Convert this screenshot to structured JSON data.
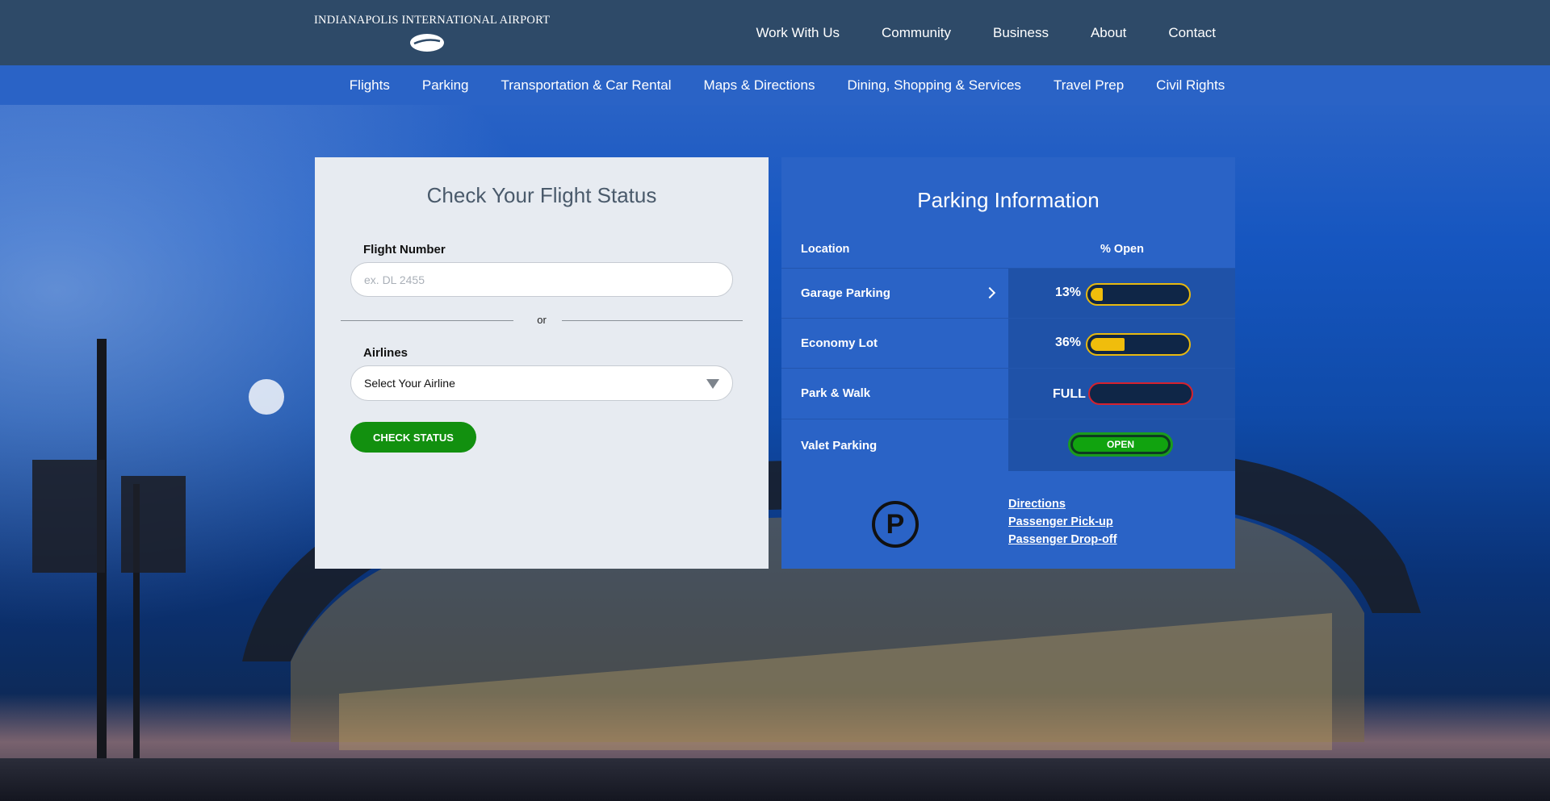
{
  "header": {
    "logo_text": "INDIANAPOLIS INTERNATIONAL AIRPORT",
    "nav": [
      "Work With Us",
      "Community",
      "Business",
      "About",
      "Contact"
    ]
  },
  "subnav": [
    "Flights",
    "Parking",
    "Transportation & Car Rental",
    "Maps & Directions",
    "Dining, Shopping & Services",
    "Travel Prep",
    "Civil Rights"
  ],
  "flight_status": {
    "title": "Check Your Flight Status",
    "flight_number_label": "Flight Number",
    "flight_number_placeholder": "ex. DL 2455",
    "flight_number_value": "",
    "or_text": "or",
    "airlines_label": "Airlines",
    "airline_selected": "Select Your Airline",
    "check_button": "CHECK STATUS"
  },
  "parking": {
    "title": "Parking Information",
    "col_location": "Location",
    "col_open": "% Open",
    "rows": [
      {
        "location": "Garage Parking",
        "status_text": "13%",
        "percent_open": 13,
        "state": "partial",
        "has_chevron": true
      },
      {
        "location": "Economy Lot",
        "status_text": "36%",
        "percent_open": 36,
        "state": "partial",
        "has_chevron": false
      },
      {
        "location": "Park & Walk",
        "status_text": "FULL",
        "percent_open": 0,
        "state": "full",
        "has_chevron": false
      },
      {
        "location": "Valet Parking",
        "status_text": "OPEN",
        "percent_open": null,
        "state": "open",
        "has_chevron": false
      }
    ],
    "icon_letter": "P",
    "links": [
      "Directions",
      "Passenger Pick-up",
      "Passenger Drop-off"
    ]
  },
  "colors": {
    "header_bg": "#2e4a68",
    "subnav_bg": "#2a63c6",
    "panel_light": "#e7ebf1",
    "panel_blue": "#2a63c6",
    "button_green": "#12900f",
    "bar_yellow": "#f0bd0c",
    "bar_full_red": "#d6222e"
  },
  "icons": {
    "logo_mark": "airplane-ellipse-icon",
    "select_caret": "caret-down-icon",
    "row_chevron": "chevron-right-icon",
    "parking_sign": "parking-circle-icon"
  }
}
